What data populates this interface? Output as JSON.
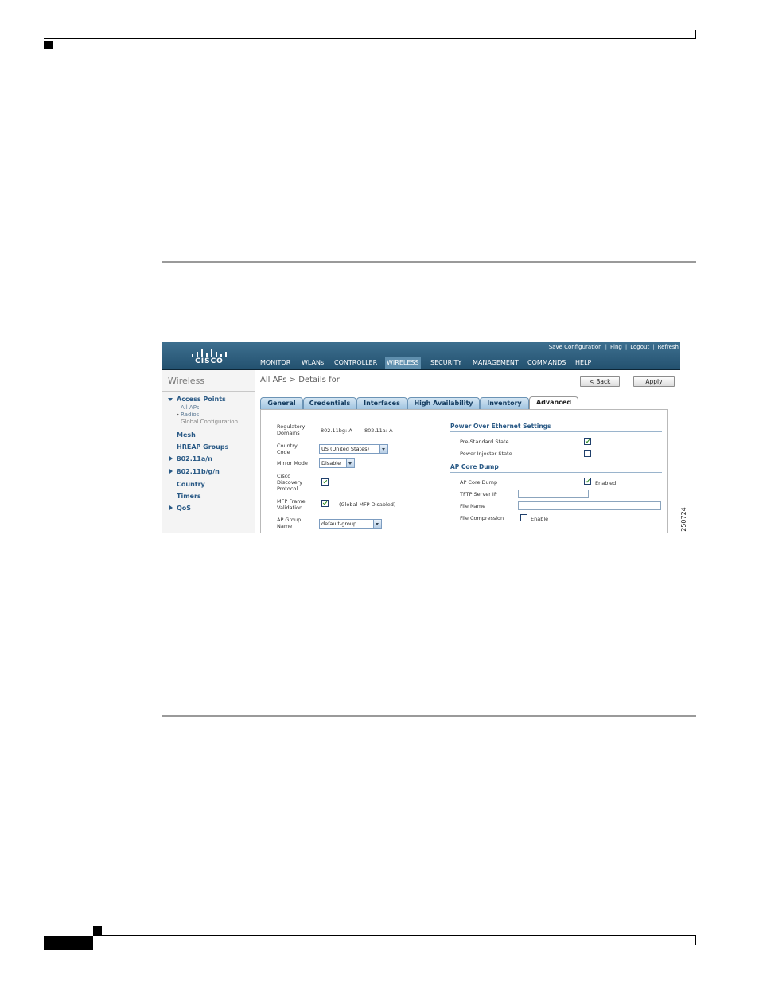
{
  "app": {
    "logo_text": "CISCO",
    "top_links": [
      "Save Configuration",
      "|",
      "Ping",
      "|",
      "Logout",
      "|",
      "Refresh"
    ],
    "menu": [
      "MONITOR",
      "WLANs",
      "CONTROLLER",
      "WIRELESS",
      "SECURITY",
      "MANAGEMENT",
      "COMMANDS",
      "HELP"
    ],
    "active_menu": "WIRELESS"
  },
  "sidebar": {
    "title": "Wireless",
    "items": [
      {
        "label": "Access Points"
      },
      {
        "label": "All APs"
      },
      {
        "label": "Radios"
      },
      {
        "label": "Global Configuration"
      },
      {
        "label": "Mesh"
      },
      {
        "label": "HREAP Groups"
      },
      {
        "label": "802.11a/n"
      },
      {
        "label": "802.11b/g/n"
      },
      {
        "label": "Country"
      },
      {
        "label": "Timers"
      },
      {
        "label": "QoS"
      }
    ]
  },
  "main": {
    "breadcrumb": "All APs > Details for",
    "back_button": "< Back",
    "apply_button": "Apply",
    "tabs": [
      "General",
      "Credentials",
      "Interfaces",
      "High Availability",
      "Inventory",
      "Advanced"
    ],
    "active_tab": "Advanced",
    "left": {
      "regulatory_label": "Regulatory Domains",
      "regulatory_bg": "802.11bg:-A",
      "regulatory_a": "802.11a:-A",
      "country_label": "Country Code",
      "country_value": "US (United States)",
      "mirror_label": "Mirror Mode",
      "mirror_value": "Disable",
      "cdp_label": "Cisco Discovery Protocol",
      "cdp_checked": true,
      "mfp_label": "MFP Frame Validation",
      "mfp_checked": true,
      "mfp_note": "(Global MFP Disabled)",
      "apgroup_label": "AP Group Name",
      "apgroup_value": "default-group"
    },
    "right": {
      "poe_section": "Power Over Ethernet Settings",
      "pre_standard_label": "Pre-Standard State",
      "pre_standard_checked": true,
      "injector_label": "Power Injector State",
      "injector_checked": false,
      "coredump_section": "AP Core Dump",
      "coredump_label": "AP Core Dump",
      "coredump_checked": true,
      "coredump_enabled": "Enabled",
      "tftp_label": "TFTP Server IP",
      "tftp_value": "",
      "filename_label": "File Name",
      "filename_value": "",
      "compression_label": "File Compression",
      "compression_checked": false,
      "compression_enable": "Enable"
    }
  },
  "figure_id": "250724"
}
